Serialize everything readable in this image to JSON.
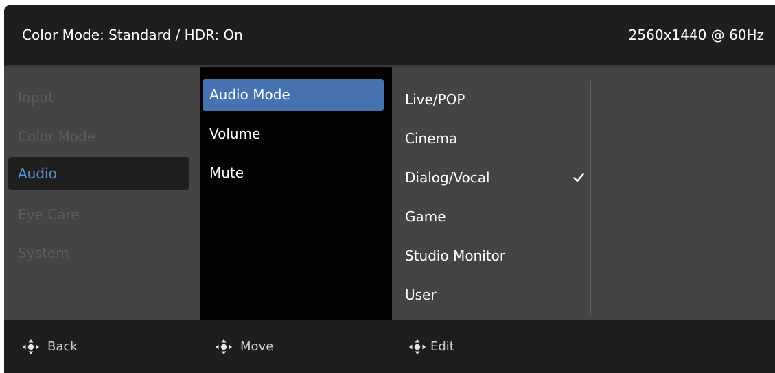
{
  "header": {
    "status": "Color Mode: Standard / HDR: On",
    "resolution": "2560x1440 @ 60Hz"
  },
  "main_menu": {
    "items": [
      {
        "label": "Input",
        "active": false
      },
      {
        "label": "Color Mode",
        "active": false
      },
      {
        "label": "Audio",
        "active": true
      },
      {
        "label": "Eye Care",
        "active": false
      },
      {
        "label": "System",
        "active": false
      }
    ]
  },
  "sub_menu": {
    "items": [
      {
        "label": "Audio Mode",
        "active": true
      },
      {
        "label": "Volume",
        "active": false
      },
      {
        "label": "Mute",
        "active": false
      }
    ]
  },
  "options": {
    "items": [
      {
        "label": "Live/POP",
        "selected": false
      },
      {
        "label": "Cinema",
        "selected": false
      },
      {
        "label": "Dialog/Vocal",
        "selected": true
      },
      {
        "label": "Game",
        "selected": false
      },
      {
        "label": "Studio Monitor",
        "selected": false
      },
      {
        "label": "User",
        "selected": false
      }
    ],
    "check_icon": "checkmark-icon"
  },
  "footer": {
    "hints": [
      {
        "label": "Back",
        "icon": "joystick-icon"
      },
      {
        "label": "Move",
        "icon": "joystick-icon"
      },
      {
        "label": "Edit",
        "icon": "joystick-icon"
      }
    ]
  },
  "colors": {
    "accent": "#4672b2",
    "active_text": "#5b8fd6",
    "panel": "#444444",
    "bar": "#1e1e1e",
    "submenu_bg": "#050202"
  }
}
